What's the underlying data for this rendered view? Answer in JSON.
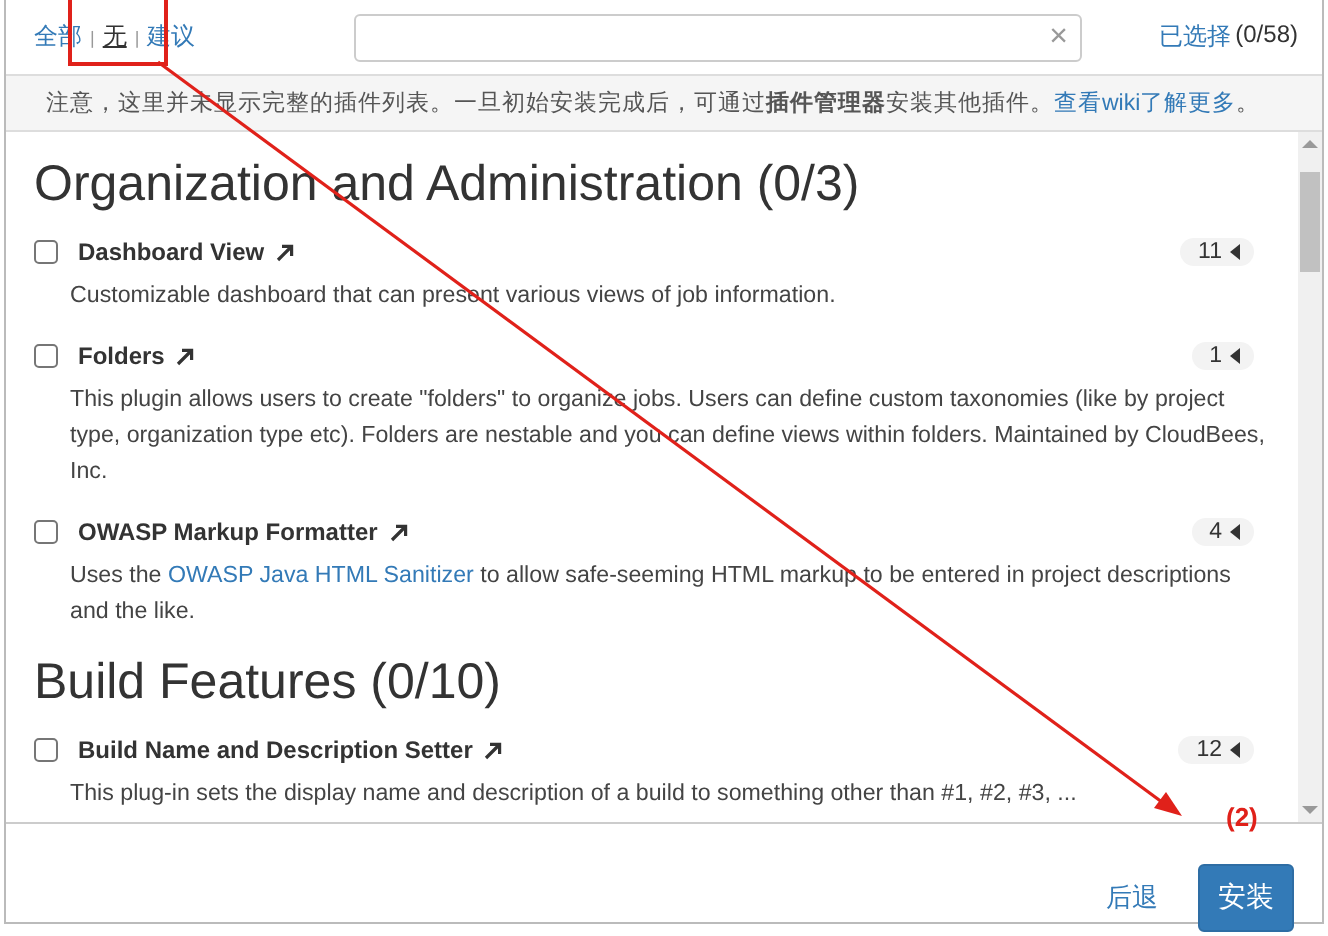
{
  "filter_links": [
    {
      "label": "全部",
      "selected": false
    },
    {
      "label": "无",
      "selected": true
    },
    {
      "label": "建议",
      "selected": false
    }
  ],
  "filter_separator": "|",
  "search": {
    "clear_glyph": "×"
  },
  "selection_count": {
    "label": "已选择",
    "count": "(0/58)"
  },
  "notice": {
    "text": "注意，这里并未显示完整的插件列表。一旦初始安装完成后，可通过**插件管理器**安装其他插件。",
    "link": "查看wiki了解更多",
    "end": "。"
  },
  "sections": [
    {
      "title": "Organization and Administration (0/3)",
      "plugins": [
        {
          "name": "Dashboard View",
          "checked": false,
          "count": "11",
          "description": [
            {
              "kind": "text",
              "text": "Customizable dashboard that can present various views of job information."
            }
          ]
        },
        {
          "name": "Folders",
          "checked": false,
          "count": "1",
          "description": [
            {
              "kind": "text",
              "text": "This plugin allows users to create \"folders\" to organize jobs. Users can define custom taxonomies (like by project type, organization type etc). Folders are nestable and you can define views within folders. Maintained by CloudBees, Inc."
            }
          ]
        },
        {
          "name": "OWASP Markup Formatter",
          "checked": false,
          "count": "4",
          "description": [
            {
              "kind": "text",
              "text": "Uses the "
            },
            {
              "kind": "link",
              "text": "OWASP Java HTML Sanitizer"
            },
            {
              "kind": "text",
              "text": " to allow safe-seeming HTML markup to be entered in project descriptions and the like."
            }
          ]
        }
      ]
    },
    {
      "title": "Build Features (0/10)",
      "plugins": [
        {
          "name": "Build Name and Description Setter",
          "checked": false,
          "count": "12",
          "description": [
            {
              "kind": "text",
              "text": "This plug-in sets the display name and description of a build to something other than #1, #2, #3, ..."
            }
          ]
        }
      ]
    }
  ],
  "footer": {
    "back": "后退",
    "install": "安装"
  },
  "annotation": {
    "label": "(2)"
  }
}
